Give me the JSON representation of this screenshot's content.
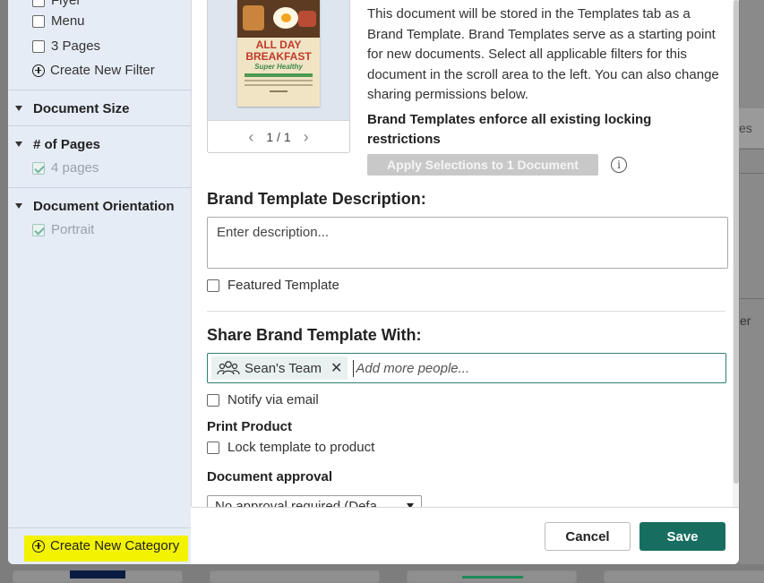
{
  "background": {
    "tab_fragment": "es",
    "text_fragment": "er"
  },
  "sidebar": {
    "filters": [
      {
        "label": "Flyer",
        "checked": false
      },
      {
        "label": "Menu",
        "checked": false
      },
      {
        "label": "3 Pages",
        "checked": false
      }
    ],
    "create_filter": "Create New Filter",
    "sections": [
      {
        "title": "Document Size"
      },
      {
        "title": "# of Pages",
        "item": "4 pages"
      },
      {
        "title": "Document Orientation",
        "item": "Portrait"
      }
    ],
    "create_category": "Create New Category"
  },
  "preview": {
    "poster_title": "ALL DAY BREAKFAST",
    "poster_subtitle": "Super Healthy",
    "page_indicator": "1 / 1"
  },
  "main": {
    "info_text": "This document will be stored in the Templates tab as a Brand Template. Brand Templates serve as a starting point for new documents. Select all applicable filters for this document in the scroll area to the left. You can also change sharing permissions below.",
    "locking_note": "Brand Templates enforce all existing locking restrictions",
    "apply_button": "Apply Selections to 1 Document",
    "description_heading": "Brand Template Description:",
    "description_placeholder": "Enter description...",
    "featured_label": "Featured Template",
    "share_heading": "Share Brand Template With:",
    "share_chip": "Sean's Team",
    "share_placeholder": "Add more people...",
    "notify_label": "Notify via email",
    "print_product_heading": "Print Product",
    "lock_label": "Lock template to product",
    "approval_heading": "Document approval",
    "approval_value": "No approval required (Defa..."
  },
  "footer": {
    "cancel": "Cancel",
    "save": "Save"
  },
  "colors": {
    "accent": "#176e60",
    "highlight": "#f3f300",
    "sidebar_bg": "#e6ecf5"
  }
}
